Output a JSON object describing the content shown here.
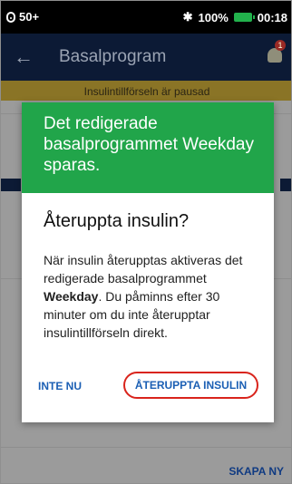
{
  "status_bar": {
    "pod_level": "50+",
    "battery_percent": "100%",
    "time": "00:18",
    "icons": [
      "pod-icon",
      "bluetooth-icon",
      "battery-icon"
    ]
  },
  "app_bar": {
    "back_icon": "arrow-left-icon",
    "title": "Basalprogram",
    "notification_count": "1"
  },
  "banner": {
    "text": "Insulintillförseln är pausad"
  },
  "background": {
    "create_label": "SKAPA NY"
  },
  "dialog": {
    "header_message": "Det redigerade basalprogrammet Weekday sparas.",
    "title": "Återuppta insulin?",
    "body_before": "När insulin återupptas aktiveras det redigerade basalprogrammet ",
    "body_program": "Weekday",
    "body_after": ". Du påminns efter 30 minuter om du inte återupptar insulintillförseln direkt.",
    "cancel_label": "INTE NU",
    "confirm_label": "ÅTERUPPTA INSULIN"
  },
  "colors": {
    "header_green": "#21a54a",
    "appbar_navy": "#0c1a35",
    "link_blue": "#1b5fb4",
    "highlight_red": "#d9241c"
  }
}
